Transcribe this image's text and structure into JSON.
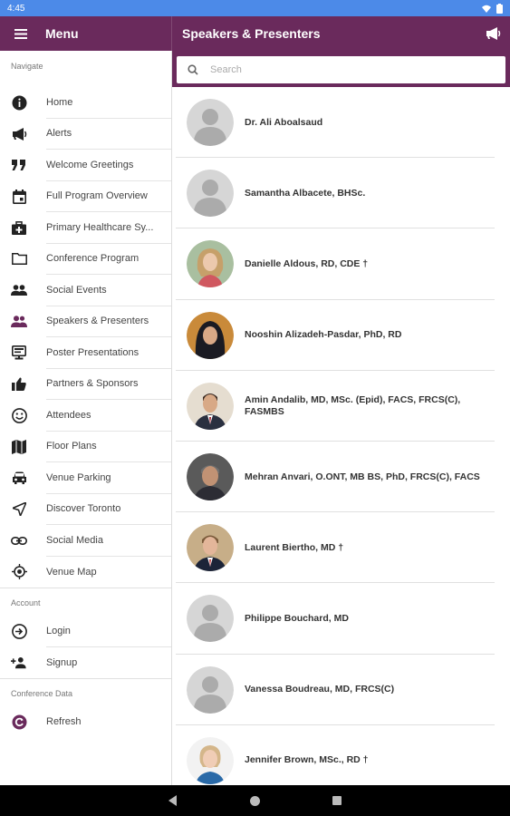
{
  "status": {
    "time": "4:45"
  },
  "menu_header": {
    "title": "Menu"
  },
  "header": {
    "title": "Speakers & Presenters"
  },
  "search": {
    "placeholder": "Search"
  },
  "sidebar": {
    "navigate_label": "Navigate",
    "items": [
      {
        "label": "Home",
        "icon": "info-icon"
      },
      {
        "label": "Alerts",
        "icon": "megaphone-icon"
      },
      {
        "label": "Welcome Greetings",
        "icon": "quote-icon"
      },
      {
        "label": "Full Program Overview",
        "icon": "calendar-icon"
      },
      {
        "label": "Primary Healthcare Sy...",
        "icon": "medical-kit-icon"
      },
      {
        "label": "Conference Program",
        "icon": "folder-icon"
      },
      {
        "label": "Social Events",
        "icon": "people-icon"
      },
      {
        "label": "Speakers & Presenters",
        "icon": "speakers-icon",
        "selected": true
      },
      {
        "label": "Poster Presentations",
        "icon": "presentation-icon"
      },
      {
        "label": "Partners & Sponsors",
        "icon": "thumbs-up-icon"
      },
      {
        "label": "Attendees",
        "icon": "smiley-icon"
      },
      {
        "label": "Floor Plans",
        "icon": "map-icon"
      },
      {
        "label": "Venue Parking",
        "icon": "car-icon"
      },
      {
        "label": "Discover Toronto",
        "icon": "navigation-icon"
      },
      {
        "label": "Social Media",
        "icon": "link-icon"
      },
      {
        "label": "Venue Map",
        "icon": "location-icon"
      }
    ],
    "account_label": "Account",
    "account_items": [
      {
        "label": "Login",
        "icon": "login-icon"
      },
      {
        "label": "Signup",
        "icon": "add-person-icon"
      }
    ],
    "conference_data_label": "Conference Data",
    "data_items": [
      {
        "label": "Refresh",
        "icon": "refresh-icon"
      }
    ]
  },
  "speakers": [
    {
      "name": "Dr. Ali Aboalsaud",
      "photo": "placeholder"
    },
    {
      "name": "Samantha Albacete, BHSc.",
      "photo": "placeholder"
    },
    {
      "name": "Danielle Aldous, RD, CDE †",
      "photo": "woman-blonde"
    },
    {
      "name": "Nooshin Alizadeh-Pasdar, PhD, RD",
      "photo": "woman-hijab"
    },
    {
      "name": "Amin Andalib, MD, MSc. (Epid), FACS, FRCS(C), FASMBS",
      "photo": "man-suit"
    },
    {
      "name": "Mehran Anvari, O.ONT, MB BS, PhD, FRCS(C), FACS",
      "photo": "man-gray"
    },
    {
      "name": "Laurent Biertho, MD †",
      "photo": "man-tie"
    },
    {
      "name": "Philippe Bouchard, MD",
      "photo": "placeholder"
    },
    {
      "name": "Vanessa Boudreau, MD, FRCS(C)",
      "photo": "placeholder"
    },
    {
      "name": "Jennifer Brown, MSc., RD †",
      "photo": "woman-blonde-short"
    }
  ],
  "colors": {
    "primary": "#6a2a5c",
    "status_bar": "#4c8ae8",
    "selected_icon": "#6a2a5c"
  }
}
